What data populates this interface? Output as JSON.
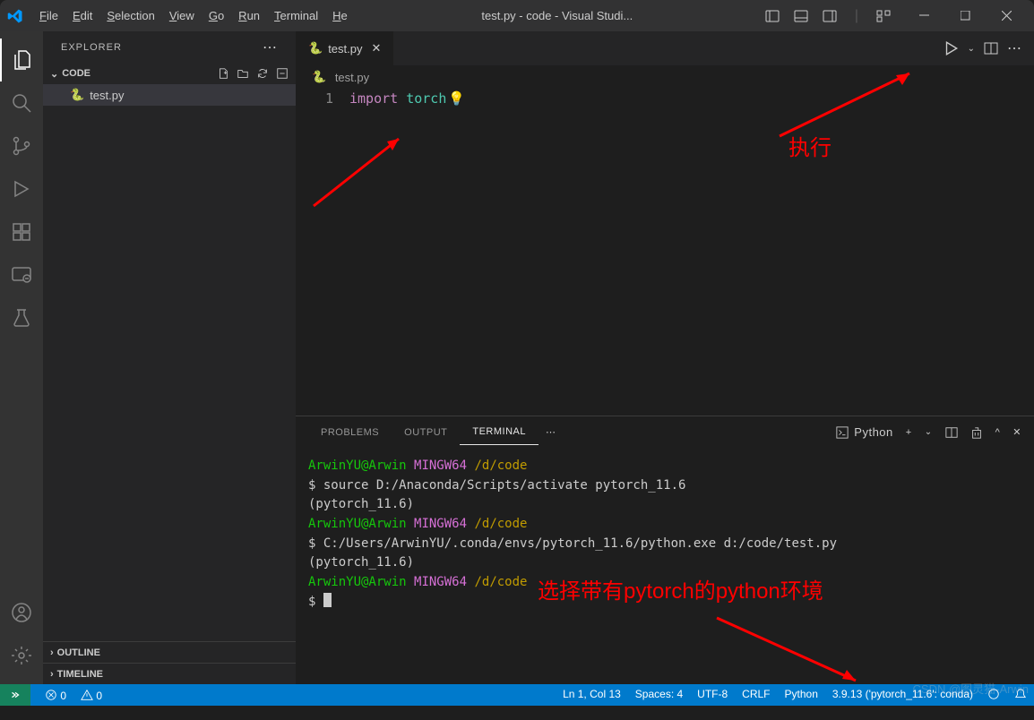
{
  "menu": {
    "file": "File",
    "edit": "Edit",
    "selection": "Selection",
    "view": "View",
    "go": "Go",
    "run": "Run",
    "terminal": "Terminal",
    "help": "He"
  },
  "title": "test.py - code - Visual Studi...",
  "explorer": {
    "title": "EXPLORER",
    "folder": "CODE",
    "file": "test.py",
    "outline": "OUTLINE",
    "timeline": "TIMELINE"
  },
  "tab": {
    "name": "test.py"
  },
  "breadcrumb": {
    "file": "test.py"
  },
  "editor": {
    "line_number": "1",
    "keyword": "import",
    "module": "torch"
  },
  "panel": {
    "tabs": {
      "problems": "PROBLEMS",
      "output": "OUTPUT",
      "terminal": "TERMINAL"
    },
    "shell": "Python"
  },
  "terminal": {
    "l1_user": "ArwinYU@Arwin",
    "l1_shell": "MINGW64",
    "l1_path": "/d/code",
    "l2": "$ source D:/Anaconda/Scripts/activate pytorch_11.6",
    "l3": "(pytorch_11.6)",
    "l4_user": "ArwinYU@Arwin",
    "l4_shell": "MINGW64",
    "l4_path": "/d/code",
    "l5": "$ C:/Users/ArwinYU/.conda/envs/pytorch_11.6/python.exe d:/code/test.py",
    "l7": "(pytorch_11.6)",
    "l8_user": "ArwinYU@Arwin",
    "l8_shell": "MINGW64",
    "l8_path": "/d/code",
    "l9": "$ "
  },
  "status": {
    "errors": "0",
    "warnings": "0",
    "ln": "Ln 1, Col 13",
    "spaces": "Spaces: 4",
    "encoding": "UTF-8",
    "eol": "CRLF",
    "lang": "Python",
    "interpreter": "3.9.13 ('pytorch_11.6': conda)"
  },
  "annotations": {
    "run": "执行",
    "env": "选择带有pytorch的python环境"
  },
  "watermark": "CSDN @图灵猫-Arwin"
}
